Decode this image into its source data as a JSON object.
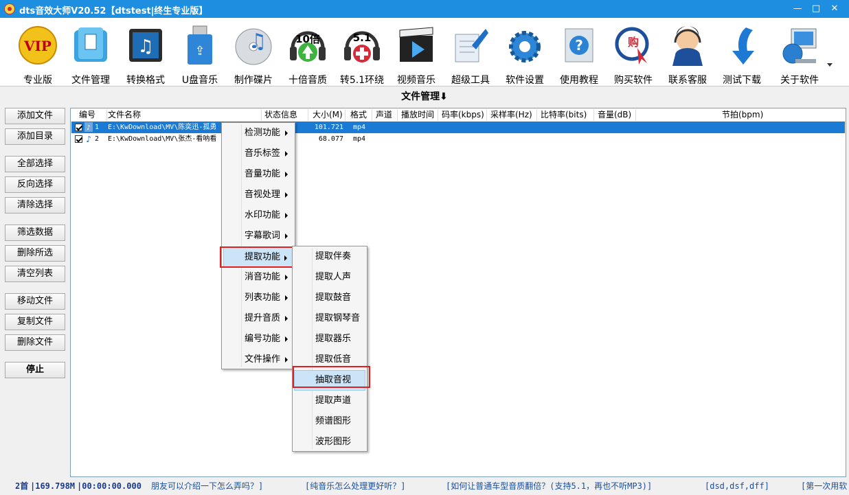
{
  "window": {
    "title": "dts音效大师V20.52【dtstest|终生专业版】",
    "minimize": "—",
    "maximize": "□",
    "close": "✕"
  },
  "toolbar": [
    {
      "label": "专业版",
      "icon": "vip-icon"
    },
    {
      "label": "文件管理",
      "icon": "file-manager-icon"
    },
    {
      "label": "转换格式",
      "icon": "music-note-icon"
    },
    {
      "label": "U盘音乐",
      "icon": "usb-drive-icon"
    },
    {
      "label": "制作碟片",
      "icon": "cd-music-icon"
    },
    {
      "label": "十倍音质",
      "icon": "headphones-10x-icon",
      "badge": "10倍"
    },
    {
      "label": "转5.1环绕",
      "icon": "headphones-51-icon",
      "badge": "5.1"
    },
    {
      "label": "视频音乐",
      "icon": "clapper-play-icon"
    },
    {
      "label": "超级工具",
      "icon": "wrench-tools-icon"
    },
    {
      "label": "软件设置",
      "icon": "gear-icon"
    },
    {
      "label": "使用教程",
      "icon": "help-question-icon"
    },
    {
      "label": "购买软件",
      "icon": "buy-cursor-icon",
      "badge": "购"
    },
    {
      "label": "联系客服",
      "icon": "customer-service-icon"
    },
    {
      "label": "测试下载",
      "icon": "download-arrow-icon"
    },
    {
      "label": "关于软件",
      "icon": "computer-globe-icon"
    }
  ],
  "section_title": "文件管理⬇",
  "sidebar": {
    "add_file": "添加文件",
    "add_dir": "添加目录",
    "select_all": "全部选择",
    "invert_select": "反向选择",
    "clear_select": "清除选择",
    "filter_data": "筛选数据",
    "delete_selected": "删除所选",
    "clear_list": "清空列表",
    "move_file": "移动文件",
    "copy_file": "复制文件",
    "delete_file": "删除文件",
    "stop": "停止"
  },
  "list": {
    "columns": [
      "编号",
      "文件名称",
      "状态信息",
      "大小(M)",
      "格式",
      "声道",
      "播放时间",
      "码率(kbps)",
      "采样率(Hz)",
      "比特率(bits)",
      "音量(dB)",
      "节拍(bpm)"
    ],
    "rows": [
      {
        "num": "1",
        "name": "E:\\KwDownload\\MV\\陈奕迅-孤勇",
        "size": "101.721",
        "format": "mp4",
        "selected": true
      },
      {
        "num": "2",
        "name": "E:\\KwDownload\\MV\\张杰-看呐看",
        "size": "68.077",
        "format": "mp4",
        "selected": false
      }
    ]
  },
  "context_menu": [
    "检测功能",
    "音乐标签",
    "音量功能",
    "音视处理",
    "水印功能",
    "字幕歌词",
    "提取功能",
    "消音功能",
    "列表功能",
    "提升音质",
    "编号功能",
    "文件操作"
  ],
  "context_menu_active": "提取功能",
  "submenu": [
    "提取伴奏",
    "提取人声",
    "提取鼓音",
    "提取钢琴音",
    "提取器乐",
    "提取低音",
    "抽取音视",
    "提取声道",
    "频谱图形",
    "波形图形"
  ],
  "submenu_active": "抽取音视",
  "status": {
    "count": "2首",
    "size": "|169.798M",
    "duration": "|00:00:00.000",
    "tip1": "朋友可以介绍一下怎么弄吗？]",
    "tip2": "[纯音乐怎么处理更好听？]",
    "tip3": "[如何让普通车型音质翻倍？(支持5.1，再也不听MP3)]",
    "tip4": "[dsd,dsf,dff]",
    "tip5": "[第一次用软"
  },
  "colors": {
    "titlebar": "#1e8fe0",
    "selection": "#1a7ad4",
    "highlight_box": "#e02020",
    "status_text": "#1a4fa0"
  }
}
